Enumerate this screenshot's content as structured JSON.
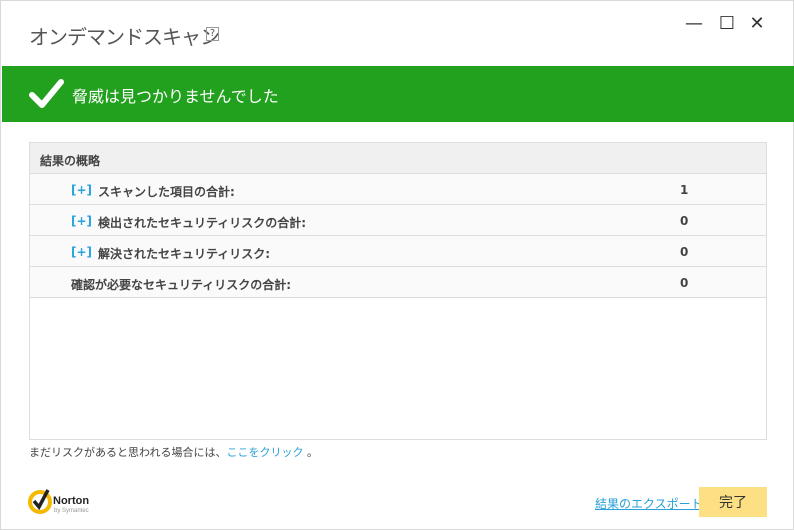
{
  "window": {
    "title": "オンデマンドスキャン",
    "help": "?",
    "minimize": "—",
    "maximize": "☐",
    "close": "✕"
  },
  "banner": {
    "message": "脅威は見つかりませんでした",
    "color": "#22a11e",
    "icon": "checkmark-icon"
  },
  "summary": {
    "header": "結果の概略",
    "expand": "[+]",
    "rows": [
      {
        "label": "スキャンした項目の合計:",
        "value": "1",
        "expandable": true
      },
      {
        "label": "検出されたセキュリティリスクの合計:",
        "value": "0",
        "expandable": true
      },
      {
        "label": "解決されたセキュリティリスク:",
        "value": "0",
        "expandable": true
      },
      {
        "label": "確認が必要なセキュリティリスクの合計:",
        "value": "0",
        "expandable": false
      }
    ]
  },
  "note": {
    "text": "まだリスクがあると思われる場合には、",
    "link": "ここをクリック",
    "end": " 。"
  },
  "footer": {
    "logo": "Norton by Symantec",
    "export": "結果のエクスポート",
    "done": "完了"
  }
}
